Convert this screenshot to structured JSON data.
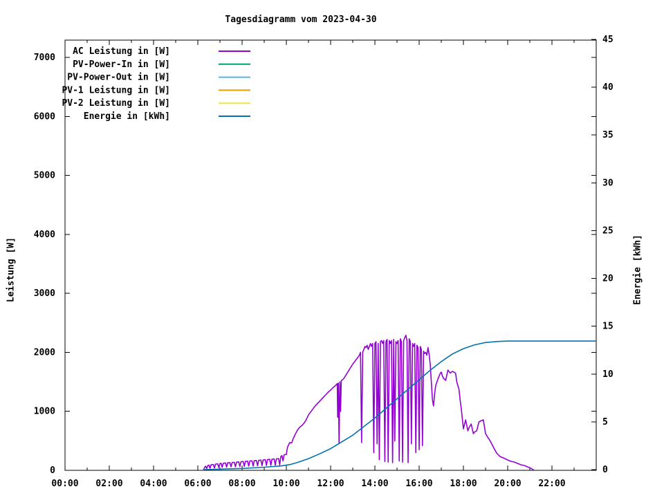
{
  "chart_data": {
    "type": "line",
    "title": "Tagesdiagramm vom 2023-04-30",
    "ylabel": "Leistung [W]",
    "y2label": "Energie [kWh]",
    "grid": false,
    "legend_position": "top-left-inside",
    "x_axis": {
      "min": 0,
      "max": 24,
      "major_ticks": [
        [
          0,
          "00:00"
        ],
        [
          2,
          "02:00"
        ],
        [
          4,
          "04:00"
        ],
        [
          6,
          "06:00"
        ],
        [
          8,
          "08:00"
        ],
        [
          10,
          "10:00"
        ],
        [
          12,
          "12:00"
        ],
        [
          14,
          "14:00"
        ],
        [
          16,
          "16:00"
        ],
        [
          18,
          "18:00"
        ],
        [
          20,
          "20:00"
        ],
        [
          22,
          "22:00"
        ]
      ],
      "minor_ticks": [
        1,
        3,
        5,
        7,
        9,
        11,
        13,
        15,
        17,
        19,
        21,
        23
      ]
    },
    "y1_axis": {
      "min": 0,
      "max": 7293,
      "ticks": [
        [
          0,
          "0"
        ],
        [
          1000,
          "1000"
        ],
        [
          2000,
          "2000"
        ],
        [
          3000,
          "3000"
        ],
        [
          4000,
          "4000"
        ],
        [
          5000,
          "5000"
        ],
        [
          6000,
          "6000"
        ],
        [
          7000,
          "7000"
        ]
      ]
    },
    "y2_axis": {
      "min": 0,
      "max": 44.93,
      "ticks": [
        [
          0,
          "0"
        ],
        [
          5,
          "5"
        ],
        [
          10,
          "10"
        ],
        [
          15,
          "15"
        ],
        [
          20,
          "20"
        ],
        [
          25,
          "25"
        ],
        [
          30,
          "30"
        ],
        [
          35,
          "35"
        ],
        [
          40,
          "40"
        ],
        [
          45,
          "45"
        ]
      ]
    },
    "series": [
      {
        "name": "ac-leistung",
        "label": "AC Leistung in [W]",
        "color": "#9400D3",
        "axis": "y1",
        "points": [
          [
            6.25,
            0
          ],
          [
            6.3,
            45
          ],
          [
            6.35,
            70
          ],
          [
            6.4,
            30
          ],
          [
            6.45,
            80
          ],
          [
            6.5,
            90
          ],
          [
            6.55,
            35
          ],
          [
            6.6,
            95
          ],
          [
            6.7,
            100
          ],
          [
            6.75,
            40
          ],
          [
            6.8,
            105
          ],
          [
            6.9,
            110
          ],
          [
            6.95,
            45
          ],
          [
            7.0,
            115
          ],
          [
            7.05,
            120
          ],
          [
            7.1,
            50
          ],
          [
            7.15,
            120
          ],
          [
            7.25,
            125
          ],
          [
            7.3,
            55
          ],
          [
            7.35,
            128
          ],
          [
            7.45,
            130
          ],
          [
            7.5,
            60
          ],
          [
            7.55,
            133
          ],
          [
            7.65,
            136
          ],
          [
            7.7,
            60
          ],
          [
            7.75,
            140
          ],
          [
            7.85,
            143
          ],
          [
            7.9,
            65
          ],
          [
            7.95,
            146
          ],
          [
            8.05,
            150
          ],
          [
            8.1,
            68
          ],
          [
            8.15,
            152
          ],
          [
            8.25,
            155
          ],
          [
            8.3,
            70
          ],
          [
            8.35,
            158
          ],
          [
            8.45,
            161
          ],
          [
            8.5,
            73
          ],
          [
            8.55,
            164
          ],
          [
            8.65,
            167
          ],
          [
            8.7,
            76
          ],
          [
            8.75,
            170
          ],
          [
            8.85,
            173
          ],
          [
            8.9,
            79
          ],
          [
            8.95,
            176
          ],
          [
            9.05,
            180
          ],
          [
            9.1,
            82
          ],
          [
            9.15,
            183
          ],
          [
            9.25,
            186
          ],
          [
            9.3,
            85
          ],
          [
            9.35,
            189
          ],
          [
            9.45,
            192
          ],
          [
            9.5,
            88
          ],
          [
            9.55,
            195
          ],
          [
            9.65,
            198
          ],
          [
            9.7,
            92
          ],
          [
            9.75,
            235
          ],
          [
            9.8,
            250
          ],
          [
            9.85,
            160
          ],
          [
            9.9,
            265
          ],
          [
            10.0,
            270
          ],
          [
            10.05,
            390
          ],
          [
            10.1,
            430
          ],
          [
            10.15,
            470
          ],
          [
            10.2,
            465
          ],
          [
            10.25,
            470
          ],
          [
            10.3,
            530
          ],
          [
            10.4,
            610
          ],
          [
            10.5,
            680
          ],
          [
            10.6,
            730
          ],
          [
            10.7,
            760
          ],
          [
            10.8,
            800
          ],
          [
            10.9,
            860
          ],
          [
            11.0,
            940
          ],
          [
            11.1,
            990
          ],
          [
            11.2,
            1040
          ],
          [
            11.3,
            1090
          ],
          [
            11.4,
            1130
          ],
          [
            11.5,
            1170
          ],
          [
            11.6,
            1210
          ],
          [
            11.7,
            1250
          ],
          [
            11.8,
            1290
          ],
          [
            11.9,
            1330
          ],
          [
            12.0,
            1360
          ],
          [
            12.1,
            1400
          ],
          [
            12.2,
            1430
          ],
          [
            12.3,
            1470
          ],
          [
            12.32,
            900
          ],
          [
            12.35,
            1480
          ],
          [
            12.38,
            450
          ],
          [
            12.42,
            1500
          ],
          [
            12.45,
            1000
          ],
          [
            12.48,
            1520
          ],
          [
            12.55,
            1540
          ],
          [
            12.6,
            1560
          ],
          [
            12.7,
            1620
          ],
          [
            12.8,
            1680
          ],
          [
            12.9,
            1740
          ],
          [
            13.0,
            1800
          ],
          [
            13.1,
            1850
          ],
          [
            13.2,
            1900
          ],
          [
            13.3,
            1950
          ],
          [
            13.35,
            2000
          ],
          [
            13.4,
            470
          ],
          [
            13.45,
            2000
          ],
          [
            13.5,
            2050
          ],
          [
            13.55,
            2100
          ],
          [
            13.6,
            2080
          ],
          [
            13.65,
            2120
          ],
          [
            13.7,
            2050
          ],
          [
            13.75,
            2100
          ],
          [
            13.8,
            2150
          ],
          [
            13.85,
            2100
          ],
          [
            13.9,
            2150
          ],
          [
            13.95,
            300
          ],
          [
            14.0,
            2150
          ],
          [
            14.05,
            2180
          ],
          [
            14.1,
            450
          ],
          [
            14.15,
            2150
          ],
          [
            14.2,
            180
          ],
          [
            14.25,
            2180
          ],
          [
            14.3,
            2200
          ],
          [
            14.35,
            2150
          ],
          [
            14.4,
            2200
          ],
          [
            14.45,
            150
          ],
          [
            14.5,
            2180
          ],
          [
            14.55,
            2220
          ],
          [
            14.6,
            140
          ],
          [
            14.65,
            2200
          ],
          [
            14.7,
            2150
          ],
          [
            14.75,
            2200
          ],
          [
            14.8,
            130
          ],
          [
            14.85,
            2220
          ],
          [
            14.9,
            500
          ],
          [
            14.95,
            2180
          ],
          [
            15.0,
            2150
          ],
          [
            15.05,
            2200
          ],
          [
            15.1,
            160
          ],
          [
            15.15,
            2230
          ],
          [
            15.2,
            2180
          ],
          [
            15.25,
            140
          ],
          [
            15.3,
            2200
          ],
          [
            15.35,
            2250
          ],
          [
            15.4,
            2290
          ],
          [
            15.45,
            2200
          ],
          [
            15.5,
            130
          ],
          [
            15.55,
            2230
          ],
          [
            15.6,
            2180
          ],
          [
            15.65,
            450
          ],
          [
            15.7,
            2150
          ],
          [
            15.75,
            2100
          ],
          [
            15.8,
            2150
          ],
          [
            15.85,
            300
          ],
          [
            15.9,
            2120
          ],
          [
            15.95,
            2080
          ],
          [
            16.0,
            350
          ],
          [
            16.05,
            2100
          ],
          [
            16.1,
            2050
          ],
          [
            16.15,
            420
          ],
          [
            16.2,
            2020
          ],
          [
            16.25,
            1980
          ],
          [
            16.3,
            2000
          ],
          [
            16.35,
            1950
          ],
          [
            16.4,
            2080
          ],
          [
            16.45,
            1970
          ],
          [
            16.5,
            1800
          ],
          [
            16.55,
            1500
          ],
          [
            16.6,
            1200
          ],
          [
            16.65,
            1090
          ],
          [
            16.7,
            1300
          ],
          [
            16.75,
            1440
          ],
          [
            16.85,
            1550
          ],
          [
            16.95,
            1640
          ],
          [
            17.0,
            1665
          ],
          [
            17.05,
            1600
          ],
          [
            17.1,
            1560
          ],
          [
            17.2,
            1525
          ],
          [
            17.3,
            1700
          ],
          [
            17.4,
            1650
          ],
          [
            17.5,
            1677
          ],
          [
            17.6,
            1660
          ],
          [
            17.65,
            1642
          ],
          [
            17.7,
            1500
          ],
          [
            17.8,
            1372
          ],
          [
            17.85,
            1200
          ],
          [
            17.9,
            1056
          ],
          [
            18.0,
            704
          ],
          [
            18.1,
            856
          ],
          [
            18.2,
            669
          ],
          [
            18.25,
            720
          ],
          [
            18.35,
            786
          ],
          [
            18.45,
            622
          ],
          [
            18.5,
            650
          ],
          [
            18.6,
            669
          ],
          [
            18.7,
            821
          ],
          [
            18.8,
            840
          ],
          [
            18.9,
            856
          ],
          [
            19.0,
            622
          ],
          [
            19.1,
            560
          ],
          [
            19.2,
            504
          ],
          [
            19.3,
            434
          ],
          [
            19.4,
            360
          ],
          [
            19.5,
            293
          ],
          [
            19.65,
            235
          ],
          [
            19.8,
            211
          ],
          [
            20.0,
            176
          ],
          [
            20.15,
            152
          ],
          [
            20.3,
            141
          ],
          [
            20.45,
            117
          ],
          [
            20.6,
            94
          ],
          [
            20.75,
            82
          ],
          [
            20.9,
            59
          ],
          [
            21.05,
            35
          ],
          [
            21.2,
            0
          ]
        ]
      },
      {
        "name": "pv-power-in",
        "label": "PV-Power-In in [W]",
        "color": "#009E73",
        "axis": "y1",
        "points": []
      },
      {
        "name": "pv-power-out",
        "label": "PV-Power-Out in [W]",
        "color": "#56B4E9",
        "axis": "y1",
        "points": []
      },
      {
        "name": "pv-1-leistung",
        "label": "PV-1 Leistung in [W]",
        "color": "#E69F00",
        "axis": "y1",
        "points": []
      },
      {
        "name": "pv-2-leistung",
        "label": "PV-2 Leistung in [W]",
        "color": "#F0E442",
        "axis": "y1",
        "points": []
      },
      {
        "name": "energie",
        "label": "Energie in [kWh]",
        "color": "#0072B2",
        "axis": "y2",
        "points": [
          [
            6.25,
            0.0
          ],
          [
            7.0,
            0.05
          ],
          [
            8.0,
            0.12
          ],
          [
            9.0,
            0.25
          ],
          [
            9.75,
            0.38
          ],
          [
            10.2,
            0.55
          ],
          [
            10.5,
            0.75
          ],
          [
            11.0,
            1.15
          ],
          [
            11.5,
            1.65
          ],
          [
            12.0,
            2.2
          ],
          [
            12.5,
            2.9
          ],
          [
            13.0,
            3.6
          ],
          [
            13.5,
            4.5
          ],
          [
            14.0,
            5.4
          ],
          [
            14.5,
            6.4
          ],
          [
            15.0,
            7.4
          ],
          [
            15.5,
            8.4
          ],
          [
            16.0,
            9.4
          ],
          [
            16.5,
            10.4
          ],
          [
            17.0,
            11.3
          ],
          [
            17.5,
            12.1
          ],
          [
            18.0,
            12.65
          ],
          [
            18.5,
            13.05
          ],
          [
            19.0,
            13.3
          ],
          [
            19.5,
            13.4
          ],
          [
            20.0,
            13.45
          ],
          [
            21.0,
            13.45
          ],
          [
            22.0,
            13.45
          ],
          [
            23.0,
            13.45
          ],
          [
            24.0,
            13.45
          ]
        ]
      }
    ]
  }
}
